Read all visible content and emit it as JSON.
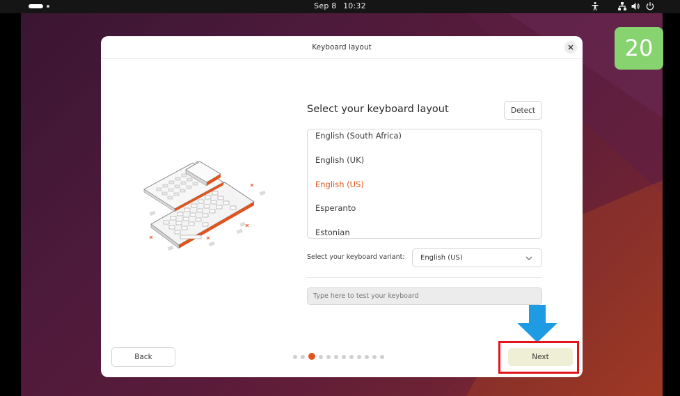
{
  "topbar": {
    "date": "Sep 8",
    "time": "10:32",
    "tray_icons": [
      "accessibility-icon",
      "network-icon",
      "volume-icon",
      "power-icon"
    ]
  },
  "step_counter": "20",
  "dialog": {
    "title": "Keyboard layout",
    "heading": "Select your keyboard layout",
    "detect_label": "Detect",
    "layouts": [
      {
        "label": "English (South Africa)",
        "selected": false
      },
      {
        "label": "English (UK)",
        "selected": false
      },
      {
        "label": "English (US)",
        "selected": true
      },
      {
        "label": "Esperanto",
        "selected": false
      },
      {
        "label": "Estonian",
        "selected": false
      }
    ],
    "variant_label": "Select your keyboard variant:",
    "variant_value": "English (US)",
    "test_placeholder": "Type here to test your keyboard",
    "back_label": "Back",
    "next_label": "Next",
    "pager": {
      "total": 12,
      "current": 3
    }
  },
  "colors": {
    "accent": "#e2541d",
    "annotation_red": "#e4141b",
    "annotation_arrow": "#1e9be3",
    "counter_bg": "#86d36f"
  }
}
